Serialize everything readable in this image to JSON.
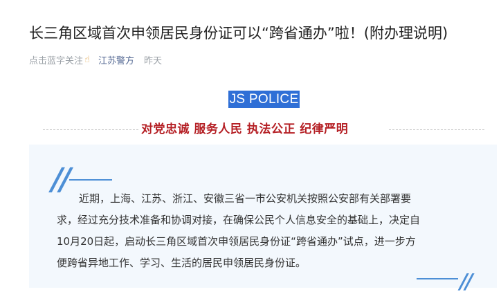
{
  "article": {
    "title": "长三角区域首次申领居民身份证可以“跨省通办”啦！(附办理说明)",
    "meta": {
      "follow_prompt": "点击蓝字关注",
      "author": "江苏警方",
      "time": "昨天"
    },
    "badge": "JS POLICE",
    "slogan": "对党忠诚  服务人民  执法公正  纪律严明",
    "paragraph_lines": [
      "近期，上海、江苏、浙江、安徽三省一市公安机关按照公安部有关部署要",
      "求，经过充分技术准备和协调对接，在确保公民个人信息安全的基础上，决定自",
      "10月20日起，启动长三角区域首次申领居民身份证“跨省通办”试点，进一步方",
      "便跨省异地工作、学习、生活的居民申领居民身份证。"
    ]
  },
  "icons": {
    "hand": "pointing-hand-icon",
    "quote": "quote-mark-icon"
  },
  "colors": {
    "badge_bg": "#2f6fd6",
    "slogan": "#b52025",
    "author_link": "#576b95",
    "quote_accent": "#4d8fd6",
    "panel_bg": "#f3f8fd"
  }
}
